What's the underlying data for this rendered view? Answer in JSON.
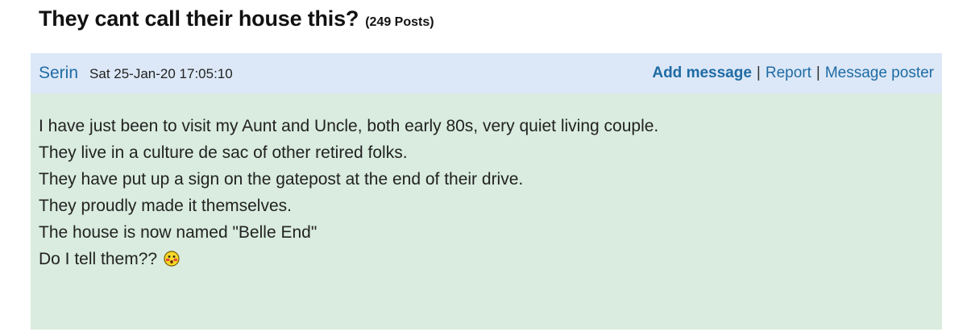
{
  "thread": {
    "title": "They cant call their house this?",
    "post_count": "(249 Posts)"
  },
  "post": {
    "poster": "Serin",
    "date": "Sat 25-Jan-20 17:05:10",
    "actions": {
      "add_message": "Add message",
      "separator": "|",
      "report": "Report",
      "message_poster": "Message poster"
    },
    "lines": [
      "I have just been to visit my Aunt and Uncle, both early 80s, very quiet living couple.",
      "They live in a culture de sac of other retired folks.",
      "They have put up a sign on the gatepost at the end of their drive.",
      "They proudly made it themselves.",
      "The house is now named \"Belle End\"",
      "Do I tell them??"
    ],
    "smiley_icon": "embarrassed-smiley-icon"
  },
  "colors": {
    "header_bg": "#dce8f7",
    "body_bg": "#d9ecdf",
    "link": "#1f6ba5"
  }
}
